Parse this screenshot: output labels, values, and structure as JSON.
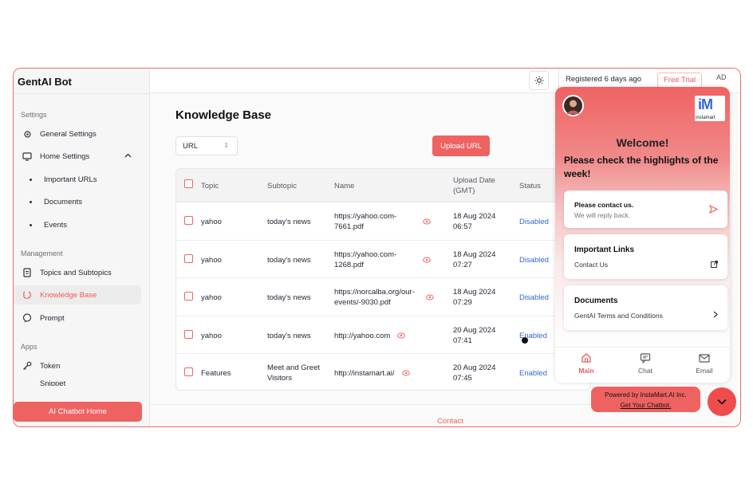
{
  "app": {
    "title": "GentAI Bot"
  },
  "sidebar": {
    "settings_label": "Settings",
    "management_label": "Management",
    "apps_label": "Apps",
    "items": [
      {
        "label": "General Settings",
        "icon": "gear-icon"
      },
      {
        "label": "Home Settings",
        "icon": "home-settings-icon"
      },
      {
        "label": "Important URLs"
      },
      {
        "label": "Documents"
      },
      {
        "label": "Events"
      },
      {
        "label": "Topics and Subtopics",
        "icon": "document-icon"
      },
      {
        "label": "Knowledge Base",
        "icon": "brain-icon",
        "active": true
      },
      {
        "label": "Prompt",
        "icon": "chat-icon"
      },
      {
        "label": "Token",
        "icon": "key-icon"
      },
      {
        "label": "Snippet"
      }
    ],
    "home_button": "AI Chatbot Home"
  },
  "topbar": {
    "registered": "Registered 6 days ago",
    "free_trial": "Free Trial",
    "avatar_initials": "AD"
  },
  "main": {
    "title": "Knowledge Base",
    "select_value": "URL",
    "upload_button": "Upload URL",
    "footer_link": "Contact"
  },
  "table": {
    "headers": {
      "topic": "Topic",
      "subtopic": "Subtopic",
      "name": "Name",
      "upload_date": "Upload Date (GMT)",
      "status": "Status"
    },
    "rows": [
      {
        "topic": "yahoo",
        "subtopic": "today's news",
        "name": "https://yahoo.com-7661.pdf",
        "date": "18 Aug 2024 06:57",
        "status": "Disabled"
      },
      {
        "topic": "yahoo",
        "subtopic": "today's news",
        "name": "https://yahoo.com-1268.pdf",
        "date": "18 Aug 2024 07:27",
        "status": "Disabled"
      },
      {
        "topic": "yahoo",
        "subtopic": "today's news",
        "name": "https://norcalba.org/our-events/-9030.pdf",
        "date": "18 Aug 2024 07:29",
        "status": "Disabled"
      },
      {
        "topic": "yahoo",
        "subtopic": "today's news",
        "name": "http://yahoo.com",
        "date": "20 Aug 2024 07:41",
        "status": "Enabled"
      },
      {
        "topic": "Features",
        "subtopic": "Meet and Greet Visitors",
        "name": "http://instamart.ai/",
        "date": "20 Aug 2024 07:45",
        "status": "Enabled"
      }
    ]
  },
  "widget": {
    "logo_text": "instamart",
    "welcome": "Welcome!",
    "highlight": "Please check the highlights of the week!",
    "contact_card": {
      "title": "Please contact us.",
      "subtitle": "We will reply back."
    },
    "links_card": {
      "title": "Important Links",
      "subtitle": "Contact Us"
    },
    "docs_card": {
      "title": "Documents",
      "subtitle": "GentAI Terms and Conditions"
    },
    "nav": {
      "main": "Main",
      "chat": "Chat",
      "email": "Email"
    },
    "powered_by": "Powered by InstaMart.AI Inc.",
    "get_chatbot": "Get Your Chatbot."
  },
  "colors": {
    "accent": "#ef6262",
    "link_blue": "#3566d6"
  }
}
